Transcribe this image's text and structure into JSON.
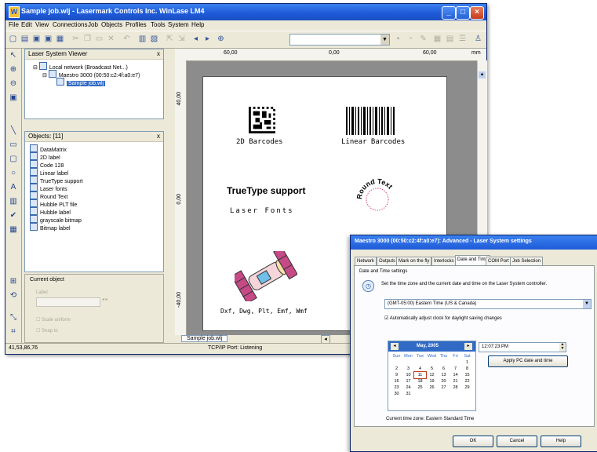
{
  "main_window": {
    "title": "Sample job.wlj - Lasermark Controls Inc. WinLase LM4",
    "menus": [
      "File",
      "Edit",
      "View",
      "Connections",
      "Job",
      "Objects",
      "Profiles",
      "Tools",
      "System",
      "Help"
    ]
  },
  "laser_viewer": {
    "title": "Laser System Viewer",
    "close": "x",
    "tree": [
      "Local network (Broadcast Net...)",
      "Maestro 3000 (00:50:c2:4f:a0:e7)",
      "Sample job.wlj"
    ]
  },
  "objects_panel": {
    "title": "Objects: [11]",
    "close": "x",
    "items": [
      "DataMatrix",
      "2D label",
      "Code 128",
      "Linear label",
      "TrueType support",
      "Laser fonts",
      "Round Text",
      "Hubble PLT file",
      "Hubble label",
      "grayscale bitmap",
      "Bitmap label"
    ]
  },
  "current_object": {
    "title": "Current object",
    "field_label": "Label",
    "checkbox_1": "Scale uniform",
    "checkbox_2": "Snap to"
  },
  "ruler": {
    "top_labels": [
      "60,00",
      "0,00",
      "60,00",
      "mm"
    ],
    "side_labels": [
      "40,00",
      "0,00",
      "-40,00"
    ]
  },
  "canvas": {
    "barcode_2d_caption": "2D Barcodes",
    "barcode_linear_caption": "Linear Barcodes",
    "truetype_text": "TrueType support",
    "laser_fonts_text": "Laser Fonts",
    "round_text": "Round Text",
    "file_formats_text": "Dxf, Dwg, Plt, Emf, Wmf"
  },
  "document_tab": "Sample job.wlj",
  "status_bar": {
    "coords": "41,53,86,76",
    "port": "TCP/IP Port: Listening"
  },
  "dialog": {
    "title": "Maestro 3000 (00:50:c2:4f:a0:e7): Advanced - Laser System settings",
    "tabs": [
      "Network",
      "Outputs",
      "Mark on the fly",
      "Interlocks",
      "Date and Time",
      "COM Port",
      "Job Selection"
    ],
    "active_tab": "Date and Time",
    "group_label": "Date and Time settings",
    "description": "Set the time zone and the current date and time on the Laser System controller.",
    "timezone": "(GMT-05:00) Eastern Time (US & Canada)",
    "dst_checkbox": "Automatically adjust clock for daylight saving changes",
    "calendar_month": "May, 2005",
    "weekdays": [
      "Sun",
      "Mon",
      "Tue",
      "Wed",
      "Thu",
      "Fri",
      "Sat"
    ],
    "calendar_rows": [
      [
        "",
        "",
        "",
        "",
        "",
        "",
        "1"
      ],
      [
        "2",
        "3",
        "4",
        "5",
        "6",
        "7",
        "8"
      ],
      [
        "9",
        "10",
        "11",
        "12",
        "13",
        "14",
        "15"
      ],
      [
        "16",
        "17",
        "18",
        "19",
        "20",
        "21",
        "22"
      ],
      [
        "23",
        "24",
        "25",
        "26",
        "27",
        "28",
        "29"
      ],
      [
        "30",
        "31",
        "",
        "",
        "",
        "",
        ""
      ]
    ],
    "selected_day": "11",
    "time_value": "12:07:23 PM",
    "apply_button": "Apply PC date and time",
    "current_zone": "Current time zone: Eastern Standard Time",
    "ok": "OK",
    "cancel": "Cancel",
    "help": "Help"
  }
}
